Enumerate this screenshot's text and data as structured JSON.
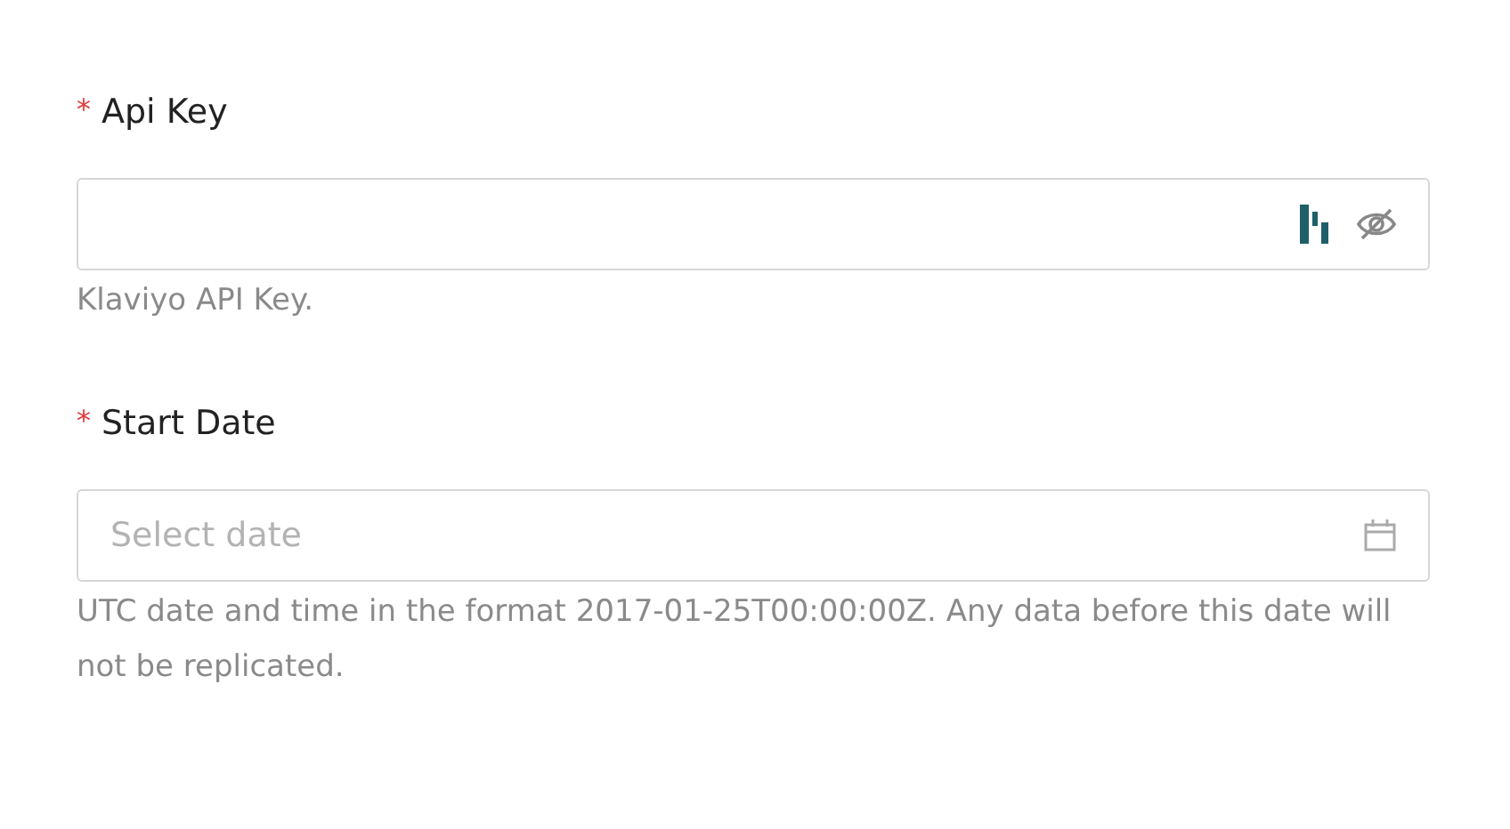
{
  "fields": [
    {
      "kind": "password",
      "required_mark": "*",
      "label": "Api Key",
      "help": "Klaviyo API Key."
    },
    {
      "kind": "date",
      "required_mark": "*",
      "label": "Start Date",
      "placeholder": "Select date",
      "help": "UTC date and time in the format 2017-01-25T00:00:00Z. Any data before this date will not be replicated."
    }
  ]
}
